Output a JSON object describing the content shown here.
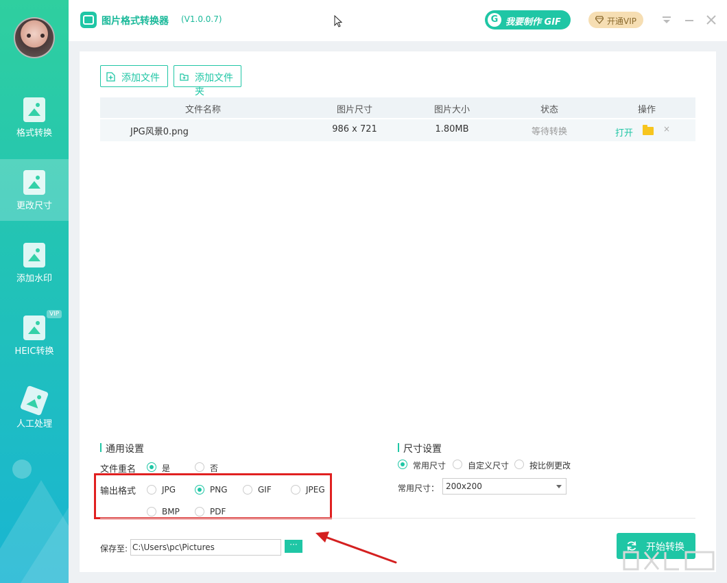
{
  "app": {
    "title": "图片格式转换器",
    "version": "(V1.0.0.7)",
    "gif_button": "我要制作 GIF",
    "gif_logo_letter": "G",
    "vip_button": "开通VIP"
  },
  "sidebar": {
    "items": [
      {
        "label": "格式转换",
        "icon": "image-convert-icon"
      },
      {
        "label": "更改尺寸",
        "icon": "image-resize-icon",
        "active": true
      },
      {
        "label": "添加水印",
        "icon": "image-watermark-icon"
      },
      {
        "label": "HEIC转换",
        "icon": "apple-image-icon",
        "badge": "VIP"
      },
      {
        "label": "人工处理",
        "icon": "manual-process-icon"
      }
    ]
  },
  "toolbar": {
    "add_file": "添加文件",
    "add_folder": "添加文件夹"
  },
  "table": {
    "headers": [
      "文件名称",
      "图片尺寸",
      "图片大小",
      "状态",
      "操作"
    ],
    "rows": [
      {
        "name": "JPG风景0.png",
        "dimensions": "986 x 721",
        "size": "1.80MB",
        "status": "等待转换",
        "open": "打开",
        "delete": "×"
      }
    ]
  },
  "general_settings": {
    "title": "通用设置",
    "rename_label": "文件重名",
    "rename_options": [
      "是",
      "否"
    ],
    "rename_selected": "是",
    "format_label": "输出格式",
    "formats": [
      "JPG",
      "PNG",
      "GIF",
      "JPEG",
      "BMP",
      "PDF"
    ],
    "format_selected": "PNG"
  },
  "size_settings": {
    "title": "尺寸设置",
    "modes": [
      "常用尺寸",
      "自定义尺寸",
      "按比例更改"
    ],
    "mode_selected": "常用尺寸",
    "common_label": "常用尺寸：",
    "common_value": "200x200"
  },
  "save": {
    "label": "保存至:",
    "path": "C:\\Users\\pc\\Pictures",
    "browse": "···"
  },
  "start_button": "开始转换",
  "colors": {
    "accent": "#1fc6a5",
    "highlight": "#e02020",
    "vip_bg": "#f6deb3"
  }
}
